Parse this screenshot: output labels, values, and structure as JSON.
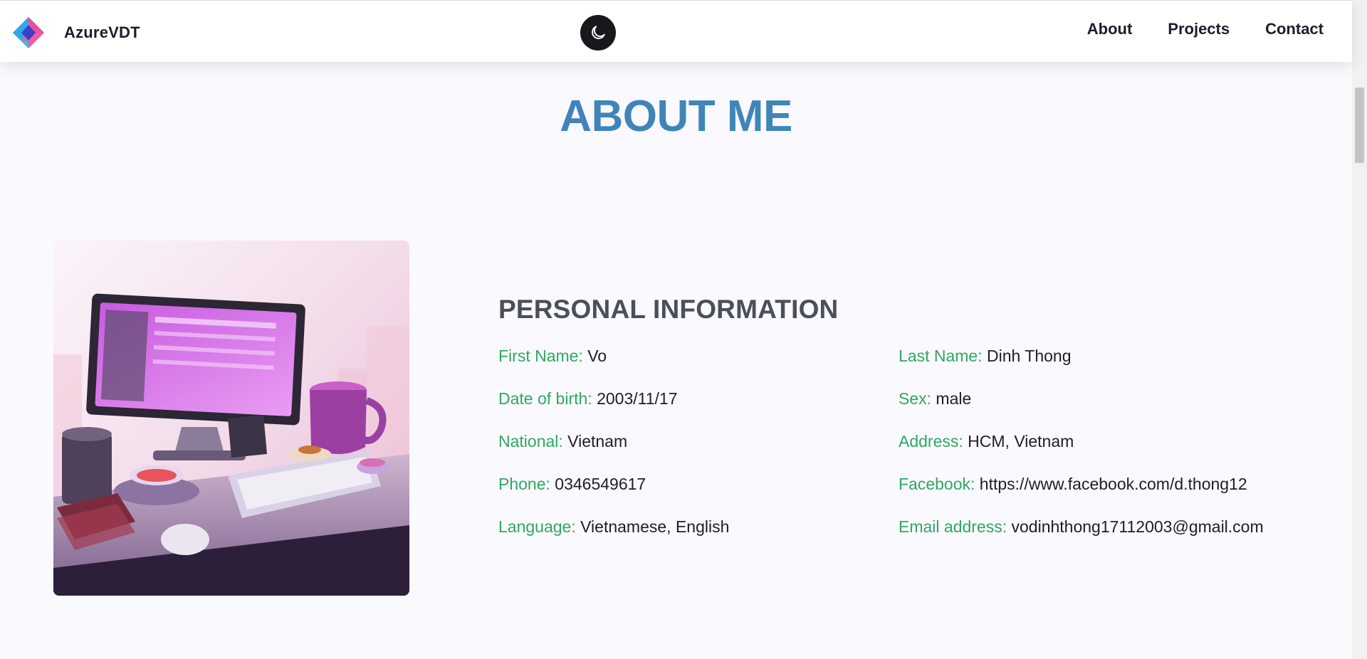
{
  "brand": {
    "name": "AzureVDT",
    "logo_icon": "cube-logo-icon"
  },
  "theme_toggle": {
    "icon": "moon-icon"
  },
  "nav": {
    "links": [
      {
        "label": "About"
      },
      {
        "label": "Projects"
      },
      {
        "label": "Contact"
      }
    ]
  },
  "about": {
    "title": "ABOUT ME",
    "image_alt": "desk-illustration",
    "personal_info": {
      "heading": "PERSONAL INFORMATION",
      "items": [
        {
          "label": "First Name:",
          "value": "Vo"
        },
        {
          "label": "Last Name:",
          "value": "Dinh Thong"
        },
        {
          "label": "Date of birth:",
          "value": "2003/11/17"
        },
        {
          "label": "Sex:",
          "value": "male"
        },
        {
          "label": "National:",
          "value": "Vietnam"
        },
        {
          "label": "Address:",
          "value": "HCM, Vietnam"
        },
        {
          "label": "Phone:",
          "value": "0346549617"
        },
        {
          "label": "Facebook:",
          "value": "https://www.facebook.com/d.thong12"
        },
        {
          "label": "Language:",
          "value": "Vietnamese, English"
        },
        {
          "label": "Email address:",
          "value": "vodinhthong17112003@gmail.com"
        }
      ]
    }
  },
  "colors": {
    "title_gradient_start": "#4b79c6",
    "title_gradient_end": "#3a92a8",
    "label_green": "#2ea862",
    "toggle_bg": "#17171c"
  }
}
